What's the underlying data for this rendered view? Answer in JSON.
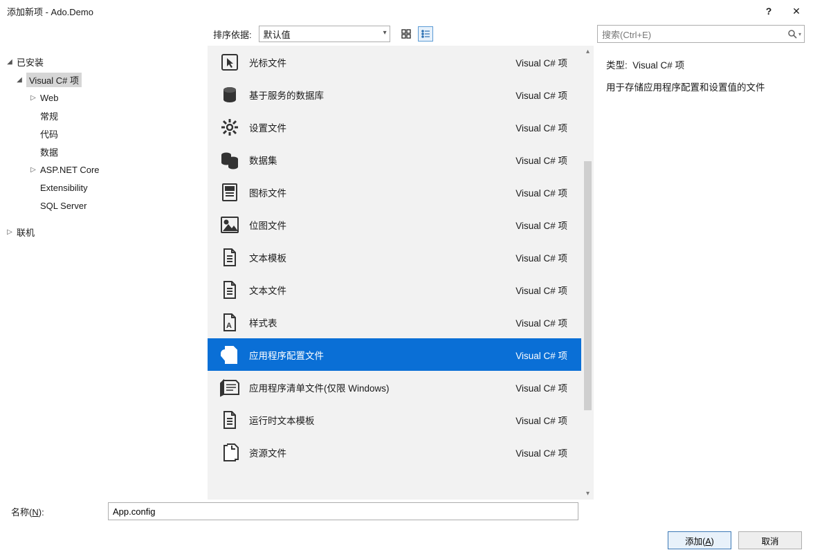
{
  "window": {
    "title": "添加新项 - Ado.Demo"
  },
  "toolbar": {
    "sort_label": "排序依据:",
    "sort_value": "默认值",
    "search_placeholder": "搜索(Ctrl+E)"
  },
  "tree": {
    "installed": "已安装",
    "csharp": "Visual C# 项",
    "items": [
      "Web",
      "常规",
      "代码",
      "数据",
      "ASP.NET Core",
      "Extensibility",
      "SQL Server"
    ],
    "online": "联机"
  },
  "templates": [
    {
      "icon": "cursor",
      "name": "光标文件",
      "lang": "Visual C# 项"
    },
    {
      "icon": "db",
      "name": "基于服务的数据库",
      "lang": "Visual C# 项"
    },
    {
      "icon": "gear",
      "name": "设置文件",
      "lang": "Visual C# 项"
    },
    {
      "icon": "dataset",
      "name": "数据集",
      "lang": "Visual C# 项"
    },
    {
      "icon": "iconfile",
      "name": "图标文件",
      "lang": "Visual C# 项"
    },
    {
      "icon": "image",
      "name": "位图文件",
      "lang": "Visual C# 项"
    },
    {
      "icon": "doc",
      "name": "文本模板",
      "lang": "Visual C# 项"
    },
    {
      "icon": "doc",
      "name": "文本文件",
      "lang": "Visual C# 项"
    },
    {
      "icon": "style",
      "name": "样式表",
      "lang": "Visual C# 项"
    },
    {
      "icon": "config",
      "name": "应用程序配置文件",
      "lang": "Visual C# 项",
      "selected": true
    },
    {
      "icon": "manifest",
      "name": "应用程序清单文件(仅限 Windows)",
      "lang": "Visual C# 项"
    },
    {
      "icon": "doc",
      "name": "运行时文本模板",
      "lang": "Visual C# 项"
    },
    {
      "icon": "resource",
      "name": "资源文件",
      "lang": "Visual C# 项"
    }
  ],
  "details": {
    "type_label": "类型:",
    "type_value": "Visual C# 项",
    "description": "用于存储应用程序配置和设置值的文件"
  },
  "footer": {
    "name_label": "名称(N):",
    "name_value": "App.config",
    "add": "添加(A)",
    "cancel": "取消"
  }
}
